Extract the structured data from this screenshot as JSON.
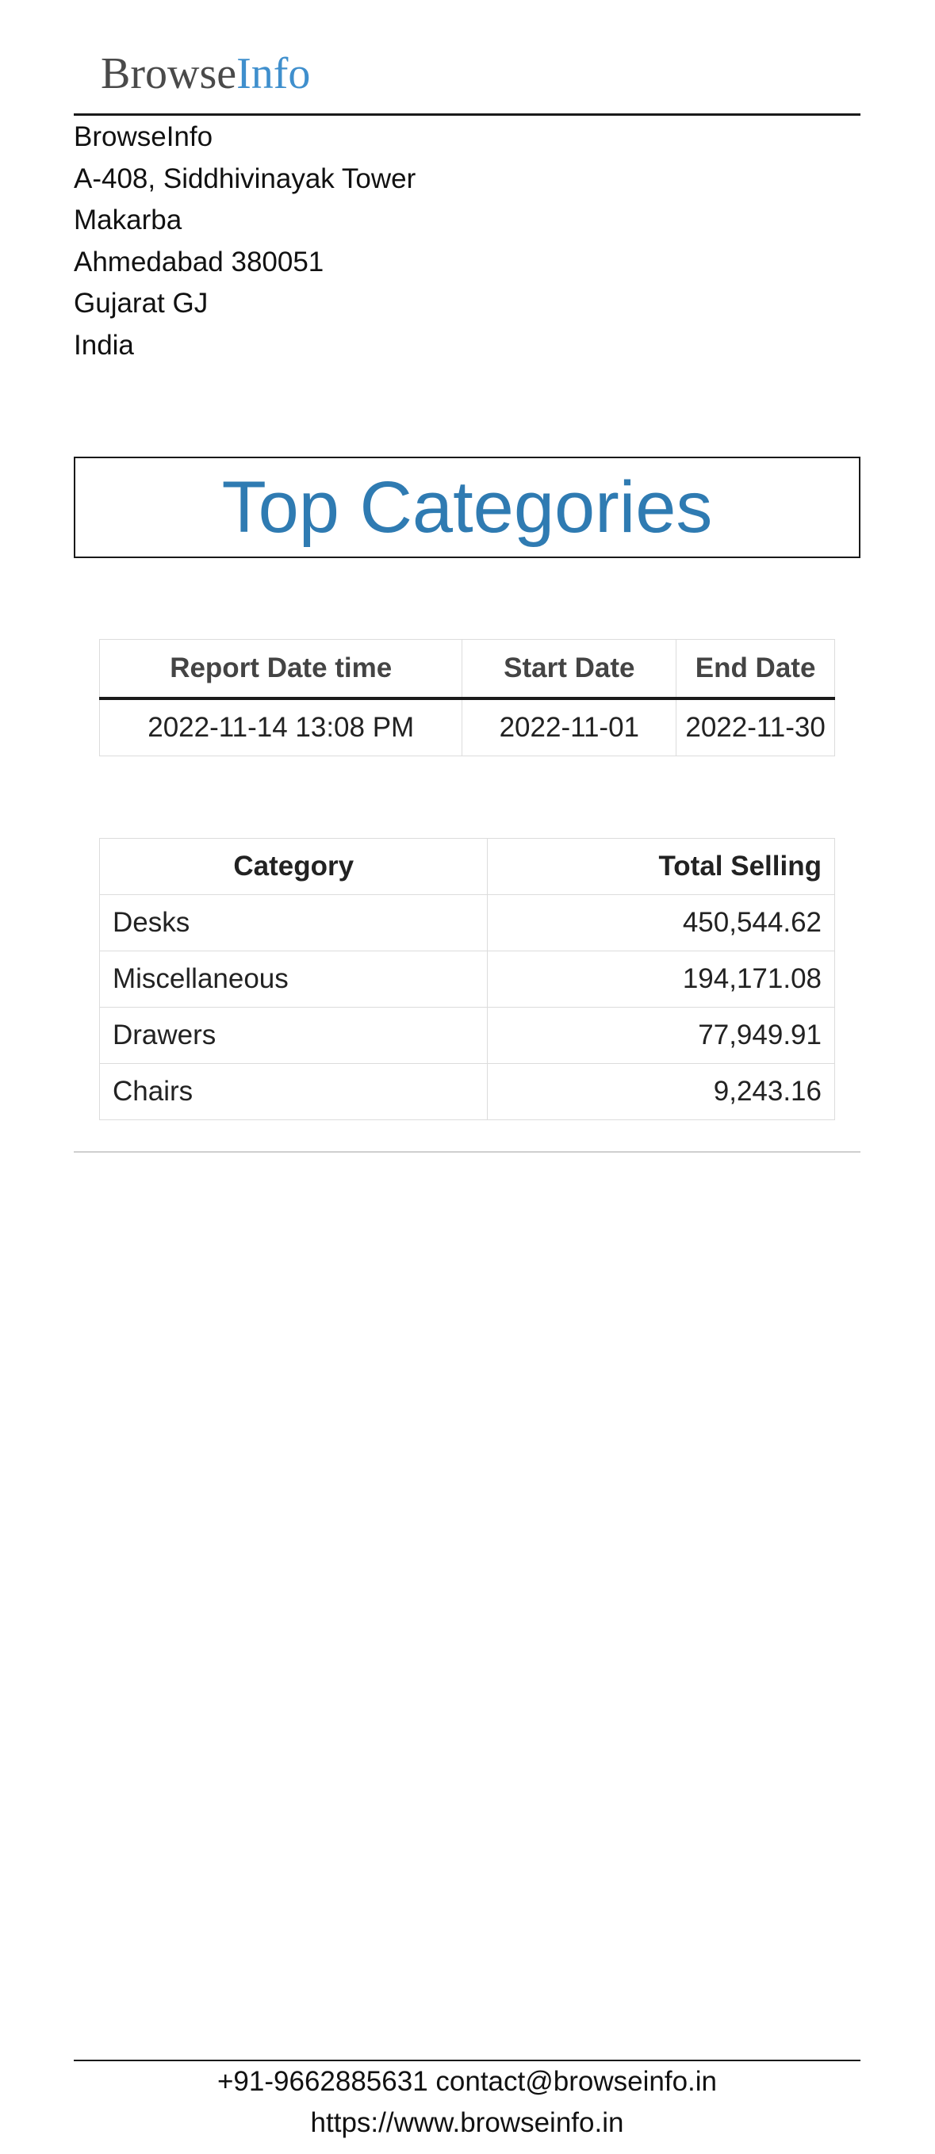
{
  "logo": {
    "part1": "Browse",
    "part2": "Info"
  },
  "company": {
    "name": "BrowseInfo",
    "address_lines": [
      "A-408, Siddhivinayak Tower",
      "Makarba",
      "Ahmedabad 380051",
      "Gujarat GJ",
      "India"
    ]
  },
  "report": {
    "title": "Top Categories",
    "info_headers": [
      "Report Date time",
      "Start Date",
      "End Date"
    ],
    "info_values": [
      "2022-11-14 13:08 PM",
      "2022-11-01",
      "2022-11-30"
    ],
    "table_headers": [
      "Category",
      "Total Selling"
    ],
    "rows": [
      {
        "category": "Desks",
        "total": "450,544.62"
      },
      {
        "category": "Miscellaneous",
        "total": "194,171.08"
      },
      {
        "category": "Drawers",
        "total": "77,949.91"
      },
      {
        "category": "Chairs",
        "total": "9,243.16"
      }
    ]
  },
  "footer": {
    "phone": "+91-9662885631",
    "email": "contact@browseinfo.in",
    "website": "https://www.browseinfo.in"
  },
  "colors": {
    "title_blue": "#2f7bb2",
    "logo_blue": "#3f8fcd",
    "logo_gray": "#4a4a4a"
  }
}
